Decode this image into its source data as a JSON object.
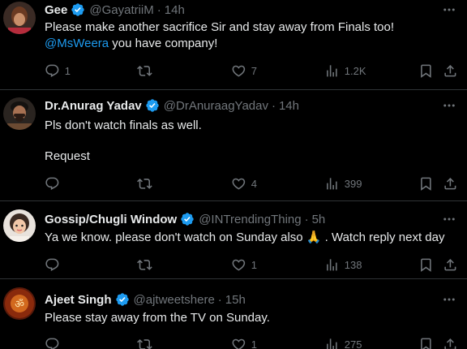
{
  "tweets": [
    {
      "name": "Gee",
      "handle": "@GayatriiM",
      "time": "14h",
      "line1": "Please make another sacrifice Sir and stay away from Finals too!",
      "mention": "@MsWeera",
      "line2_rest": " you have company!",
      "replies": "1",
      "retweets": "",
      "likes": "7",
      "views": "1.2K"
    },
    {
      "name": "Dr.Anurag Yadav",
      "handle": "@DrAnuraagYadav",
      "time": "14h",
      "line1": "Pls don't watch finals as well.",
      "line2": "Request",
      "replies": "",
      "retweets": "",
      "likes": "4",
      "views": "399"
    },
    {
      "name": "Gossip/Chugli Window",
      "handle": "@INTrendingThing",
      "time": "5h",
      "line1_a": "Ya we know. please don't watch on Sunday also ",
      "emoji": "🙏",
      "line1_b": " . Watch reply next day",
      "replies": "",
      "retweets": "",
      "likes": "1",
      "views": "138"
    },
    {
      "name": "Ajeet Singh",
      "handle": "@ajtweetshere",
      "time": "15h",
      "line1": "Please stay away from the TV on Sunday.",
      "replies": "",
      "retweets": "",
      "likes": "1",
      "views": "275"
    }
  ],
  "colors": {
    "background": "#000000",
    "accent": "#1d9bf0",
    "muted": "#71767b",
    "divider": "#2f3336"
  },
  "icons": [
    "verified-badge-icon",
    "more-icon",
    "reply-icon",
    "retweet-icon",
    "like-icon",
    "views-icon",
    "bookmark-icon",
    "share-icon"
  ]
}
